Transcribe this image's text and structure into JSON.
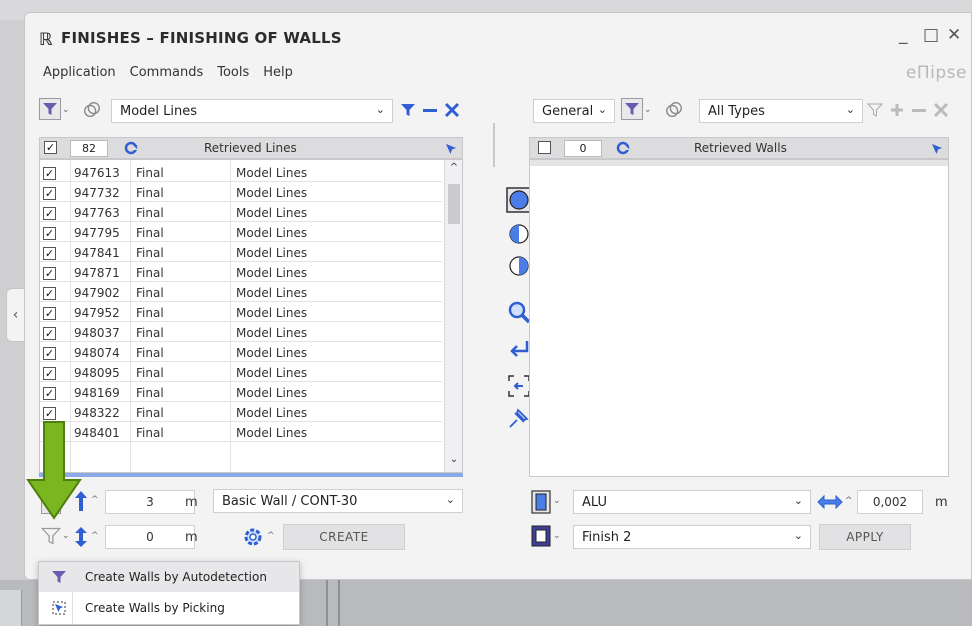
{
  "window": {
    "title": "FINISHES – FINISHING OF WALLS",
    "logo_glyph": "ℝ",
    "minimize_glyph": "_",
    "maximize_glyph": "□",
    "close_glyph": "✕",
    "brand": "eΠipse"
  },
  "menu": [
    "Application",
    "Commands",
    "Tools",
    "Help"
  ],
  "left": {
    "filter_combo": "Model Lines",
    "count": "82",
    "header_title": "Retrieved Lines",
    "rows": [
      {
        "id": "947613",
        "status": "Final",
        "type": "Model Lines"
      },
      {
        "id": "947732",
        "status": "Final",
        "type": "Model Lines"
      },
      {
        "id": "947763",
        "status": "Final",
        "type": "Model Lines"
      },
      {
        "id": "947795",
        "status": "Final",
        "type": "Model Lines"
      },
      {
        "id": "947841",
        "status": "Final",
        "type": "Model Lines"
      },
      {
        "id": "947871",
        "status": "Final",
        "type": "Model Lines"
      },
      {
        "id": "947902",
        "status": "Final",
        "type": "Model Lines"
      },
      {
        "id": "947952",
        "status": "Final",
        "type": "Model Lines"
      },
      {
        "id": "948037",
        "status": "Final",
        "type": "Model Lines"
      },
      {
        "id": "948074",
        "status": "Final",
        "type": "Model Lines"
      },
      {
        "id": "948095",
        "status": "Final",
        "type": "Model Lines"
      },
      {
        "id": "948169",
        "status": "Final",
        "type": "Model Lines"
      },
      {
        "id": "948322",
        "status": "Final",
        "type": "Model Lines"
      },
      {
        "id": "948401",
        "status": "Final",
        "type": "Model Lines"
      }
    ],
    "height_value": "3",
    "offset_value": "0",
    "unit": "m",
    "wall_type": "Basic Wall / CONT-30",
    "create_label": "CREATE"
  },
  "right": {
    "category_combo": "General",
    "types_combo": "All Types",
    "count": "0",
    "header_title": "Retrieved Walls",
    "material": "ALU",
    "thickness": "0,002",
    "unit": "m",
    "finish": "Finish 2",
    "apply_label": "APPLY"
  },
  "popup": {
    "items": [
      "Create Walls by Autodetection",
      "Create Walls by Picking"
    ]
  },
  "icons": {
    "filter": "funnel-icon",
    "link": "link-rings-icon",
    "refresh": "refresh-icon",
    "pick": "cursor-pick-icon"
  },
  "colors": {
    "accent_blue": "#2f5fd0",
    "funnel_purple": "#6b5bb0",
    "highlight_arrow": "#7ab61f",
    "progress": "#8aa9e6"
  }
}
